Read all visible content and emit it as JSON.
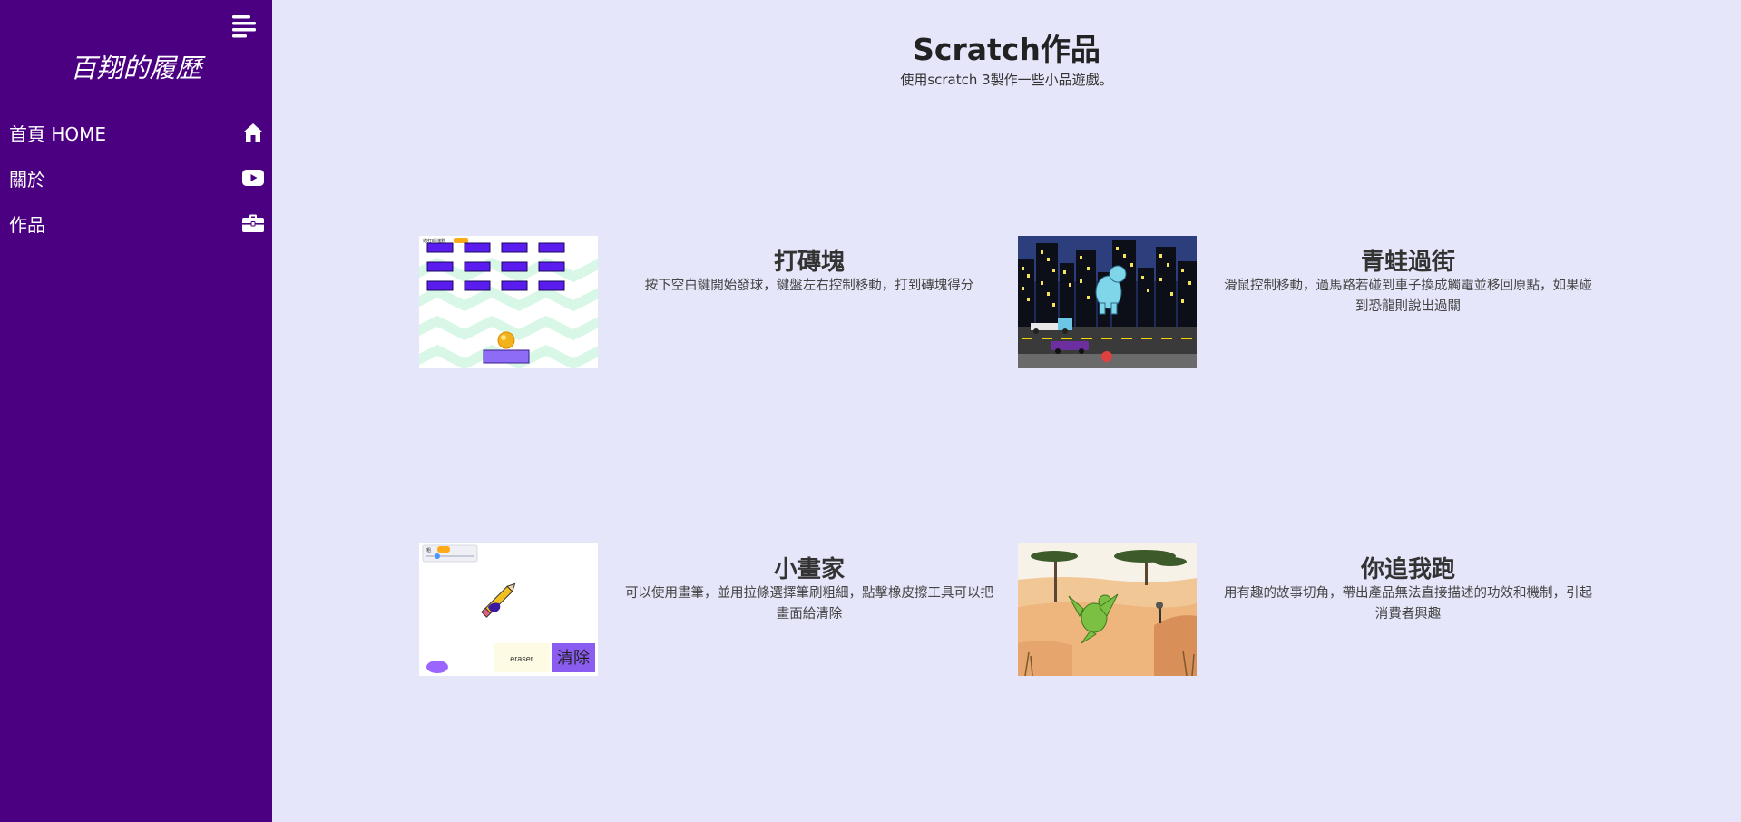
{
  "sidebar": {
    "brand": "百翔的履歷",
    "nav": [
      {
        "label": "首頁 HOME",
        "icon": "home-icon"
      },
      {
        "label": "關於",
        "icon": "youtube-icon"
      },
      {
        "label": "作品",
        "icon": "briefcase-icon"
      }
    ]
  },
  "main": {
    "title": "Scratch作品",
    "subtitle": "使用scratch 3製作一些小品遊戲。",
    "cards": [
      {
        "title": "打磚塊",
        "desc": "按下空白鍵開始發球，鍵盤左右控制移動，打到磚塊得分",
        "thumb": {
          "score_label": "總打磚塊數"
        }
      },
      {
        "title": "青蛙過街",
        "desc": "滑鼠控制移動，過馬路若碰到車子換成觸電並移回原點，如果碰到恐龍則說出過關"
      },
      {
        "title": "小畫家",
        "desc": "可以使用畫筆，並用拉條選擇筆刷粗細，點擊橡皮擦工具可以把畫面給清除",
        "thumb": {
          "eraser_label": "eraser",
          "clear_label": "清除",
          "slider_label": "粗"
        }
      },
      {
        "title": "你追我跑",
        "desc": "用有趣的故事切角，帶出產品無法直接描述的功效和機制，引起消費者興趣"
      }
    ]
  },
  "colors": {
    "sidebar_bg": "#4b0082",
    "page_bg": "#e6e6fa",
    "brick": "#5b1cf0"
  }
}
